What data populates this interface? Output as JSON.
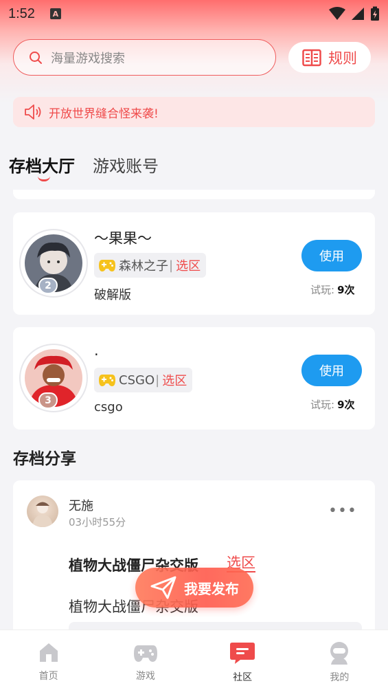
{
  "status_bar": {
    "time": "1:52",
    "notification_letter": "A"
  },
  "search": {
    "placeholder": "海量游戏搜索"
  },
  "rules_button": {
    "label": "规则"
  },
  "notice": {
    "text": "开放世界缝合怪来袭!"
  },
  "tabs": [
    {
      "label": "存档大厅",
      "active": true
    },
    {
      "label": "游戏账号",
      "active": false
    }
  ],
  "saves": [
    {
      "name": "～果果～",
      "game": "森林之子",
      "separator": "|",
      "zone": "选区",
      "description": "破解版",
      "button": "使用",
      "trial_label": "试玩:",
      "trial_count": "9次",
      "rank": "2"
    },
    {
      "name": ".",
      "game": "CSGO",
      "separator": "|",
      "zone": "选区",
      "description": "csgo",
      "button": "使用",
      "trial_label": "试玩:",
      "trial_count": "9次",
      "rank": "3"
    }
  ],
  "section": {
    "title": "存档分享"
  },
  "post": {
    "user": "无施",
    "time": "03小时55分",
    "title": "植物大战僵尸杂交版",
    "zone": "选区",
    "body": "植物大战僵尸杂交版"
  },
  "publish_button": {
    "label": "我要发布"
  },
  "bottom_nav": [
    {
      "label": "首页",
      "icon": "home-icon",
      "active": false
    },
    {
      "label": "游戏",
      "icon": "gamepad-icon",
      "active": false
    },
    {
      "label": "社区",
      "icon": "community-icon",
      "active": true
    },
    {
      "label": "我的",
      "icon": "profile-icon",
      "active": false
    }
  ],
  "colors": {
    "accent": "#ef4b4b",
    "use_button": "#1e9bf0",
    "tag_icon": "#f6c21c"
  }
}
